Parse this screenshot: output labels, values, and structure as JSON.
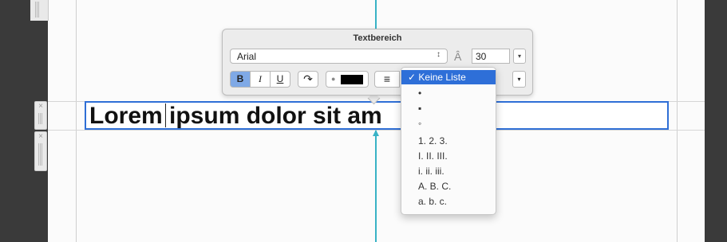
{
  "popover": {
    "title": "Textbereich",
    "font": "Arial",
    "font_size": "30",
    "size_icon": "Â",
    "select_arrow": "↕",
    "dropdown_arrow": "▾",
    "buttons": {
      "bold": "B",
      "italic": "I",
      "underline": "U",
      "redo": "↷",
      "align": "≡"
    },
    "text_color": "#000000"
  },
  "list_menu": {
    "items": [
      "✓ Keine Liste",
      "•",
      "▪",
      "◦",
      "1. 2. 3.",
      "I. II. III.",
      "i. ii. iii.",
      "A. B. C.",
      "a. b. c."
    ],
    "selected_index": 0
  },
  "textbox": {
    "text": "Lorem ipsum dolor sit am"
  },
  "colors": {
    "accent": "#2e6fd8",
    "guide": "#39b3c6"
  }
}
